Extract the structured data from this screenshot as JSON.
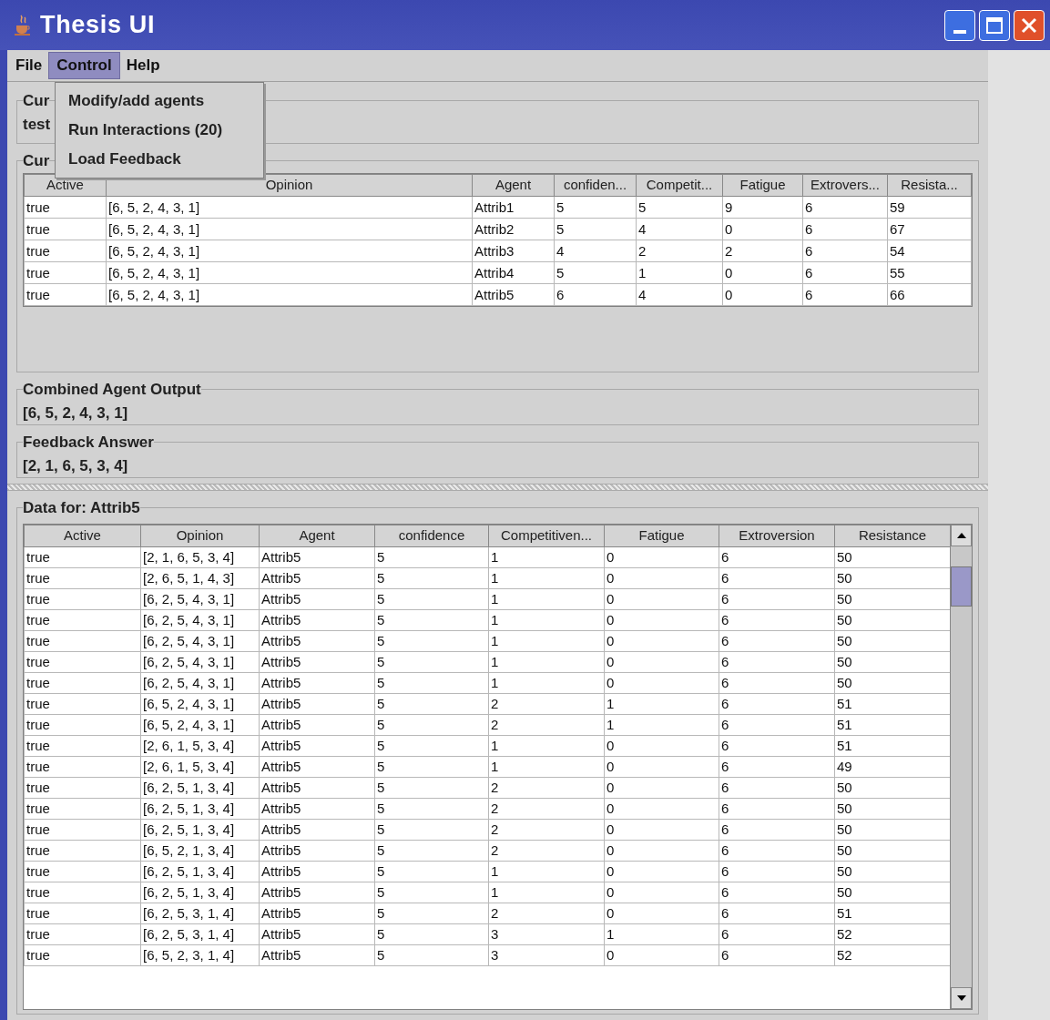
{
  "window": {
    "title": "Thesis UI"
  },
  "menu_bar": [
    {
      "label": "File",
      "selected": false
    },
    {
      "label": "Control",
      "selected": true
    },
    {
      "label": "Help",
      "selected": false
    }
  ],
  "open_menu": {
    "items": [
      "Modify/add agents",
      "Run Interactions (20)",
      "Load Feedback"
    ]
  },
  "current_panel": {
    "title": "Cur",
    "value": "test"
  },
  "agents_panel": {
    "title": "Cur",
    "table": {
      "columns": [
        "Active",
        "Opinion",
        "Agent",
        "confiden...",
        "Competit...",
        "Fatigue",
        "Extrovers...",
        "Resista..."
      ],
      "rows": [
        [
          "true",
          "[6, 5, 2, 4, 3, 1]",
          "Attrib1",
          "5",
          "5",
          "9",
          "6",
          "59"
        ],
        [
          "true",
          "[6, 5, 2, 4, 3, 1]",
          "Attrib2",
          "5",
          "4",
          "0",
          "6",
          "67"
        ],
        [
          "true",
          "[6, 5, 2, 4, 3, 1]",
          "Attrib3",
          "4",
          "2",
          "2",
          "6",
          "54"
        ],
        [
          "true",
          "[6, 5, 2, 4, 3, 1]",
          "Attrib4",
          "5",
          "1",
          "0",
          "6",
          "55"
        ],
        [
          "true",
          "[6, 5, 2, 4, 3, 1]",
          "Attrib5",
          "6",
          "4",
          "0",
          "6",
          "66"
        ]
      ]
    }
  },
  "combined_output": {
    "title": "Combined Agent Output",
    "value": "[6, 5, 2, 4, 3, 1]"
  },
  "feedback_answer": {
    "title": "Feedback Answer",
    "value": "[2, 1, 6, 5, 3, 4]"
  },
  "data_panel": {
    "title": "Data for: Attrib5",
    "table": {
      "columns": [
        "Active",
        "Opinion",
        "Agent",
        "confidence",
        "Competitiven...",
        "Fatigue",
        "Extroversion",
        "Resistance"
      ],
      "rows": [
        [
          "true",
          "[2, 1, 6, 5, 3, 4]",
          "Attrib5",
          "5",
          "1",
          "0",
          "6",
          "50"
        ],
        [
          "true",
          "[2, 6, 5, 1, 4, 3]",
          "Attrib5",
          "5",
          "1",
          "0",
          "6",
          "50"
        ],
        [
          "true",
          "[6, 2, 5, 4, 3, 1]",
          "Attrib5",
          "5",
          "1",
          "0",
          "6",
          "50"
        ],
        [
          "true",
          "[6, 2, 5, 4, 3, 1]",
          "Attrib5",
          "5",
          "1",
          "0",
          "6",
          "50"
        ],
        [
          "true",
          "[6, 2, 5, 4, 3, 1]",
          "Attrib5",
          "5",
          "1",
          "0",
          "6",
          "50"
        ],
        [
          "true",
          "[6, 2, 5, 4, 3, 1]",
          "Attrib5",
          "5",
          "1",
          "0",
          "6",
          "50"
        ],
        [
          "true",
          "[6, 2, 5, 4, 3, 1]",
          "Attrib5",
          "5",
          "1",
          "0",
          "6",
          "50"
        ],
        [
          "true",
          "[6, 5, 2, 4, 3, 1]",
          "Attrib5",
          "5",
          "2",
          "1",
          "6",
          "51"
        ],
        [
          "true",
          "[6, 5, 2, 4, 3, 1]",
          "Attrib5",
          "5",
          "2",
          "1",
          "6",
          "51"
        ],
        [
          "true",
          "[2, 6, 1, 5, 3, 4]",
          "Attrib5",
          "5",
          "1",
          "0",
          "6",
          "51"
        ],
        [
          "true",
          "[2, 6, 1, 5, 3, 4]",
          "Attrib5",
          "5",
          "1",
          "0",
          "6",
          "49"
        ],
        [
          "true",
          "[6, 2, 5, 1, 3, 4]",
          "Attrib5",
          "5",
          "2",
          "0",
          "6",
          "50"
        ],
        [
          "true",
          "[6, 2, 5, 1, 3, 4]",
          "Attrib5",
          "5",
          "2",
          "0",
          "6",
          "50"
        ],
        [
          "true",
          "[6, 2, 5, 1, 3, 4]",
          "Attrib5",
          "5",
          "2",
          "0",
          "6",
          "50"
        ],
        [
          "true",
          "[6, 5, 2, 1, 3, 4]",
          "Attrib5",
          "5",
          "2",
          "0",
          "6",
          "50"
        ],
        [
          "true",
          "[6, 2, 5, 1, 3, 4]",
          "Attrib5",
          "5",
          "1",
          "0",
          "6",
          "50"
        ],
        [
          "true",
          "[6, 2, 5, 1, 3, 4]",
          "Attrib5",
          "5",
          "1",
          "0",
          "6",
          "50"
        ],
        [
          "true",
          "[6, 2, 5, 3, 1, 4]",
          "Attrib5",
          "5",
          "2",
          "0",
          "6",
          "51"
        ],
        [
          "true",
          "[6, 2, 5, 3, 1, 4]",
          "Attrib5",
          "5",
          "3",
          "1",
          "6",
          "52"
        ],
        [
          "true",
          "[6, 5, 2, 3, 1, 4]",
          "Attrib5",
          "5",
          "3",
          "0",
          "6",
          "52"
        ]
      ]
    }
  }
}
